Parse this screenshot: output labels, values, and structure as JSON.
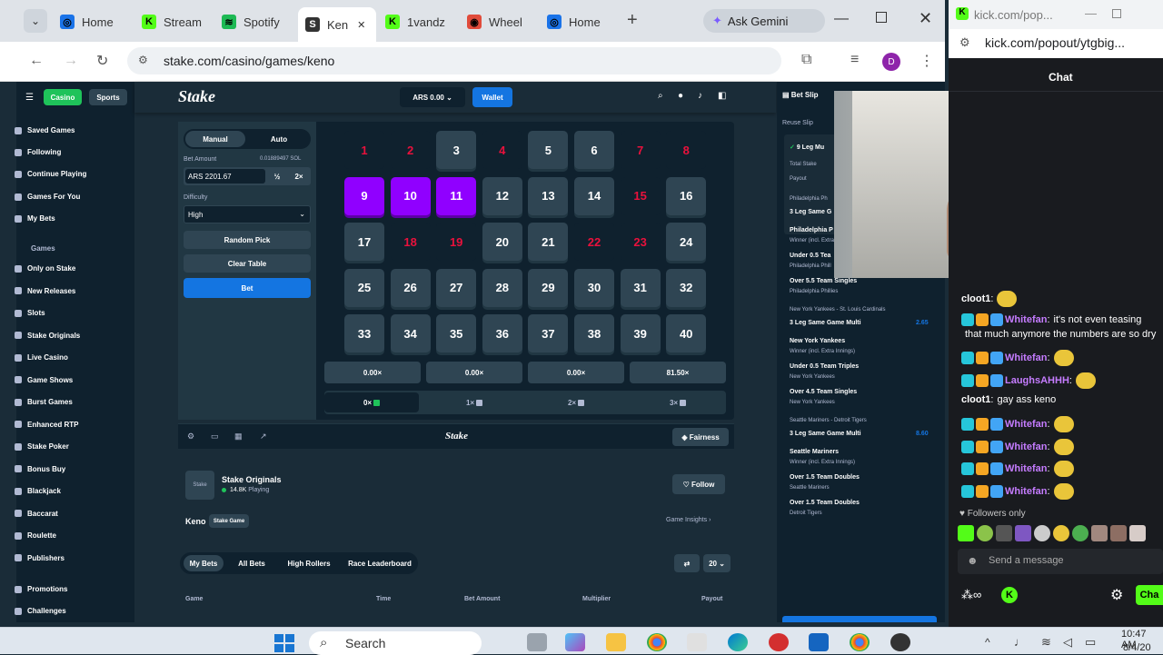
{
  "browser": {
    "tabs": [
      {
        "label": "Home",
        "color": "#1a73e8",
        "glyph": "◎"
      },
      {
        "label": "Stream",
        "color": "#53fc18",
        "glyph": "K"
      },
      {
        "label": "Spotify",
        "color": "#1db954",
        "glyph": "≋"
      },
      {
        "label": "Ken",
        "color": "#ffffff",
        "glyph": "S"
      },
      {
        "label": "1vandz",
        "color": "#53fc18",
        "glyph": "K"
      },
      {
        "label": "Wheel",
        "color": "#e04b3b",
        "glyph": "◉"
      },
      {
        "label": "Home",
        "color": "#1a73e8",
        "glyph": "◎"
      }
    ],
    "gemini": "Ask Gemini",
    "url": "stake.com/casino/games/keno",
    "profile_initial": "D"
  },
  "stake": {
    "nav": {
      "casino": "Casino",
      "sports": "Sports",
      "logo": "Stake",
      "balance": "ARS 0.00",
      "wallet": "Wallet",
      "betslip": "Bet Slip"
    },
    "sidebar": [
      "Saved Games",
      "Following",
      "Continue Playing",
      "Games For You",
      "My Bets"
    ],
    "sidebar_header": "Games",
    "sidebar_games": [
      "Only on Stake",
      "New Releases",
      "Slots",
      "Stake Originals",
      "Live Casino",
      "Game Shows",
      "Burst Games",
      "Enhanced RTP",
      "Stake Poker",
      "Bonus Buy",
      "Blackjack",
      "Baccarat",
      "Roulette",
      "Publishers"
    ],
    "sidebar_bottom": [
      "Promotions",
      "Challenges"
    ],
    "controls": {
      "manual": "Manual",
      "auto": "Auto",
      "bet_amount_label": "Bet Amount",
      "bet_amount_sol": "0.01889497 SOL",
      "bet_value": "ARS 2201.67",
      "half": "½",
      "double": "2×",
      "difficulty_label": "Difficulty",
      "difficulty": "High",
      "random_pick": "Random Pick",
      "clear_table": "Clear Table",
      "bet": "Bet"
    },
    "grid": {
      "numbers": [
        "1",
        "2",
        "3",
        "4",
        "5",
        "6",
        "7",
        "8",
        "9",
        "10",
        "11",
        "12",
        "13",
        "14",
        "15",
        "16",
        "17",
        "18",
        "19",
        "20",
        "21",
        "22",
        "23",
        "24",
        "25",
        "26",
        "27",
        "28",
        "29",
        "30",
        "31",
        "32",
        "33",
        "34",
        "35",
        "36",
        "37",
        "38",
        "39",
        "40"
      ],
      "red": [
        1,
        2,
        4,
        7,
        8,
        15,
        18,
        19,
        22,
        23
      ],
      "picked": [
        9,
        10,
        11
      ]
    },
    "multipliers": [
      "0.00×",
      "0.00×",
      "0.00×",
      "81.50×"
    ],
    "hits": [
      "0×",
      "1×",
      "2×",
      "3×"
    ],
    "footer": {
      "logo": "Stake",
      "fairness": "Fairness"
    },
    "originals": {
      "title": "Stake Originals",
      "playing": "14.8K",
      "playing_label": "Playing",
      "follow": "Follow",
      "game": "Keno",
      "tag": "Stake Game",
      "insights": "Game Insights"
    },
    "bets_tabs": [
      "My Bets",
      "All Bets",
      "High Rollers",
      "Race Leaderboard"
    ],
    "bets_count": "20",
    "table_headers": [
      "Game",
      "Time",
      "Bet Amount",
      "Multiplier",
      "Payout"
    ],
    "slip": {
      "reuse": "Reuse Slip",
      "legs": "9 Leg Mu",
      "total_stake": "Total Stake",
      "payout": "Payout",
      "groups": [
        {
          "match": "Philadelphia Ph",
          "title": "3 Leg Same G",
          "odds": "",
          "lines": [
            {
              "b": "Philadelphia P",
              "s": "Winner (incl. Extra"
            },
            {
              "b": "Under 0.5 Tea",
              "s": "Philadelphia Phill"
            },
            {
              "b": "Over 5.5 Team Singles",
              "s": "Philadelphia Phillies"
            }
          ]
        },
        {
          "match": "New York Yankees - St. Louis Cardinals",
          "title": "3 Leg Same Game Multi",
          "odds": "2.65",
          "lines": [
            {
              "b": "New York Yankees",
              "s": "Winner (incl. Extra Innings)"
            },
            {
              "b": "Under 0.5 Team Triples",
              "s": "New York Yankees"
            },
            {
              "b": "Over 4.5 Team Singles",
              "s": "New York Yankees"
            }
          ]
        },
        {
          "match": "Seattle Mariners - Detroit Tigers",
          "title": "3 Leg Same Game Multi",
          "odds": "8.60",
          "lines": [
            {
              "b": "Seattle Mariners",
              "s": "Winner (incl. Extra Innings)"
            },
            {
              "b": "Over 1.5 Team Doubles",
              "s": "Seattle Mariners"
            },
            {
              "b": "Over 1.5 Team Doubles",
              "s": "Detroit Tigers"
            }
          ]
        }
      ]
    }
  },
  "kick": {
    "title": "kick.com/pop...",
    "url": "kick.com/popout/ytgbig...",
    "chat_label": "Chat",
    "messages": [
      {
        "user": "cloot1",
        "text": "",
        "color": "#ffffff",
        "badges": 0,
        "emote": true
      },
      {
        "user": "Whitefan",
        "text": "it's not even teasing",
        "color": "#c57cff",
        "badges": 3,
        "emote": false
      },
      {
        "user": "",
        "text": "that much anymore the numbers are so dry",
        "color": "#ffffff",
        "badges": 0,
        "emote": false
      },
      {
        "user": "Whitefan",
        "text": "",
        "color": "#c57cff",
        "badges": 3,
        "emote": true
      },
      {
        "user": "LaughsAHHH",
        "text": "",
        "color": "#c57cff",
        "badges": 3,
        "emote": true
      },
      {
        "user": "cloot1",
        "text": "gay ass keno",
        "color": "#ffffff",
        "badges": 0,
        "emote": false
      },
      {
        "user": "Whitefan",
        "text": "",
        "color": "#c57cff",
        "badges": 3,
        "emote": true
      },
      {
        "user": "Whitefan",
        "text": "",
        "color": "#c57cff",
        "badges": 3,
        "emote": true
      },
      {
        "user": "Whitefan",
        "text": "",
        "color": "#c57cff",
        "badges": 3,
        "emote": true
      },
      {
        "user": "Whitefan",
        "text": "",
        "color": "#c57cff",
        "badges": 3,
        "emote": true
      }
    ],
    "followers_only": "Followers only",
    "send_placeholder": "Send a message",
    "chat_button": "Cha"
  },
  "taskbar": {
    "search": "Search",
    "time": "10:47 AM",
    "date": "8/4/20"
  }
}
